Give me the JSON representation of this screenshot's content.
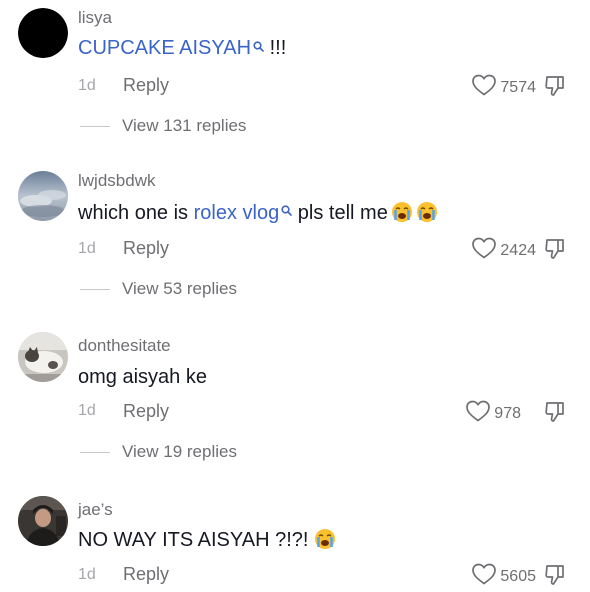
{
  "comments": [
    {
      "username": "lisya",
      "text_parts": [
        "",
        "CUPCAKE AISYAH",
        " !!!"
      ],
      "time": "1d",
      "reply_label": "Reply",
      "likes": "7574",
      "view_replies": "View 131 replies",
      "avatar": "black-circle"
    },
    {
      "username": "lwjdsbdwk",
      "text_parts": [
        "which one is ",
        "rolex vlog",
        " pls tell me"
      ],
      "emojis": [
        "loudly-crying-face",
        "loudly-crying-face"
      ],
      "time": "1d",
      "reply_label": "Reply",
      "likes": "2424",
      "view_replies": "View 53 replies",
      "avatar": "cloudy-sky"
    },
    {
      "username": "donthesitate",
      "text_parts": [
        "omg aisyah ke",
        "",
        ""
      ],
      "time": "1d",
      "reply_label": "Reply",
      "likes": "978",
      "view_replies": "View 19 replies",
      "avatar": "cat-photo"
    },
    {
      "username": "jae’s",
      "text_parts": [
        "NO WAY ITS AISYAH ?!?!",
        "",
        ""
      ],
      "emojis": [
        "loudly-crying-face"
      ],
      "time": "1d",
      "reply_label": "Reply",
      "likes": "5605",
      "avatar": "person-photo"
    }
  ],
  "colors": {
    "link": "#3b64c8",
    "secondary_text": "#6f6f73",
    "meta_text": "#a7a7ab"
  }
}
